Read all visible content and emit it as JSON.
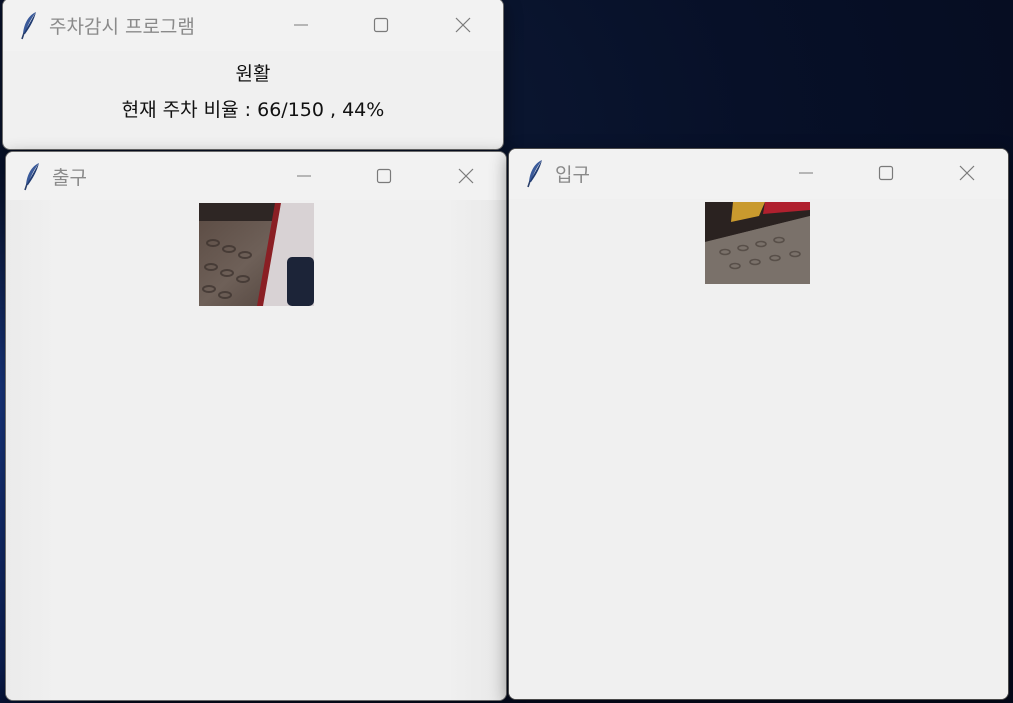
{
  "windows": {
    "main": {
      "title": "주차감시 프로그램",
      "status": "원활",
      "ratio_text": "현재 주차 비율 : 66/150 , 44%"
    },
    "exit": {
      "title": "출구",
      "camera_icon": "camera-feed"
    },
    "entrance": {
      "title": "입구",
      "camera_icon": "camera-feed"
    }
  },
  "controls": {
    "minimize_icon": "minimize-icon",
    "maximize_icon": "maximize-icon",
    "close_icon": "close-icon"
  },
  "colors": {
    "desktop_bg": "#071028",
    "window_bg": "#f0f0f0",
    "title_text": "#8a8a8a",
    "body_text": "#111111"
  }
}
